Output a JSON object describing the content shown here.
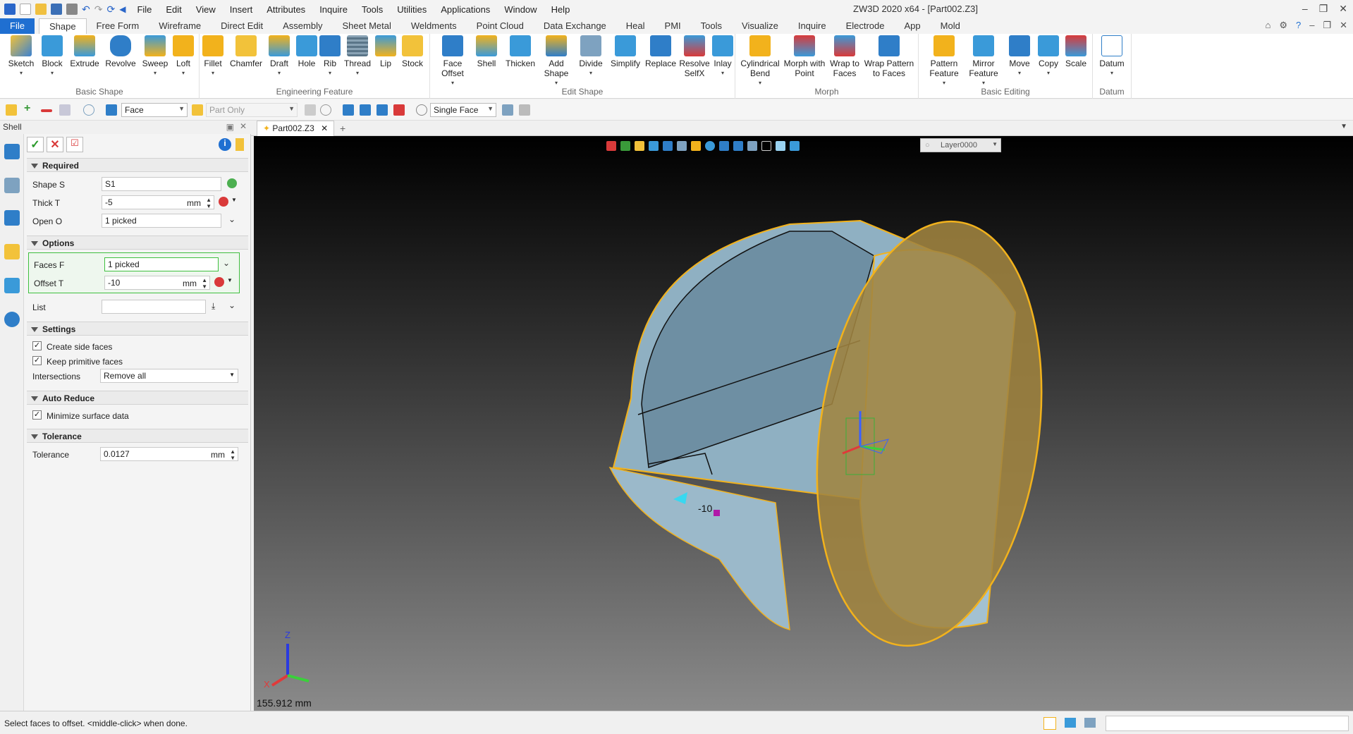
{
  "menu": [
    "File",
    "Edit",
    "View",
    "Insert",
    "Attributes",
    "Inquire",
    "Tools",
    "Utilities",
    "Applications",
    "Window",
    "Help"
  ],
  "app_title": "ZW3D 2020 x64 - [Part002.Z3]",
  "ribbon_tabs": [
    "File",
    "Shape",
    "Free Form",
    "Wireframe",
    "Direct Edit",
    "Assembly",
    "Sheet Metal",
    "Weldments",
    "Point Cloud",
    "Data Exchange",
    "Heal",
    "PMI",
    "Tools",
    "Visualize",
    "Inquire",
    "Electrode",
    "App",
    "Mold"
  ],
  "active_tab": "Shape",
  "groups": {
    "basic_shape": {
      "title": "Basic Shape",
      "tools": [
        "Sketch",
        "Block",
        "Extrude",
        "Revolve",
        "Sweep",
        "Loft"
      ]
    },
    "engineering_feature": {
      "title": "Engineering Feature",
      "tools": [
        "Fillet",
        "Chamfer",
        "Draft",
        "Hole",
        "Rib",
        "Thread",
        "Lip",
        "Stock"
      ]
    },
    "edit_shape": {
      "title": "Edit Shape",
      "tools": [
        "Face Offset",
        "Shell",
        "Thicken",
        "Add Shape",
        "Divide",
        "Simplify",
        "Replace",
        "Resolve SelfX",
        "Inlay"
      ]
    },
    "morph": {
      "title": "Morph",
      "tools": [
        "Cylindrical Bend",
        "Morph with Point",
        "Wrap to Faces",
        "Wrap Pattern to Faces"
      ]
    },
    "basic_editing": {
      "title": "Basic Editing",
      "tools": [
        "Pattern Feature",
        "Mirror Feature",
        "Move",
        "Copy",
        "Scale"
      ]
    },
    "datum": {
      "title": "Datum",
      "tools": [
        "Datum"
      ]
    }
  },
  "toolbar2": {
    "filter": "Face",
    "scope": "Part Only",
    "pick_mode": "Single Face"
  },
  "panel": {
    "title": "Shell",
    "required": {
      "heading": "Required",
      "shape_label": "Shape S",
      "shape_value": "S1",
      "thick_label": "Thick T",
      "thick_value": "-5",
      "thick_unit": "mm",
      "open_label": "Open O",
      "open_value": "1 picked"
    },
    "options": {
      "heading": "Options",
      "faces_label": "Faces F",
      "faces_value": "1 picked",
      "offset_label": "Offset T",
      "offset_value": "-10",
      "offset_unit": "mm",
      "list_label": "List",
      "list_value": ""
    },
    "settings": {
      "heading": "Settings",
      "create_side_faces": "Create side faces",
      "keep_primitive_faces": "Keep primitive faces",
      "intersections_label": "Intersections",
      "intersections_value": "Remove all"
    },
    "auto_reduce": {
      "heading": "Auto Reduce",
      "minimize": "Minimize surface data"
    },
    "tolerance": {
      "heading": "Tolerance",
      "label": "Tolerance",
      "value": "0.0127",
      "unit": "mm"
    }
  },
  "doc_tab": "Part002.Z3",
  "layer": "Layer0000",
  "viewport": {
    "dim_label": "-10",
    "readout": "155.912 mm",
    "axis_x": "X",
    "axis_z": "Z"
  },
  "status": "Select faces to offset.  <middle-click> when done.",
  "colors": {
    "accent": "#1f6fd1",
    "shell_face": "#8fb0c2",
    "highlight_face": "#a08440",
    "edge_highlight": "#f2b21c"
  }
}
